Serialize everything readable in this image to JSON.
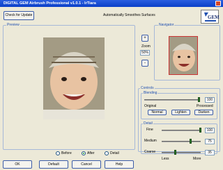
{
  "window": {
    "title": "DIGITAL GEM Airbrush Professional v1.0.1 - IrTiara"
  },
  "header": {
    "check_update": "Check for Update",
    "subtitle": "Automatically Smoothes Surfaces",
    "logo_text": "GEM"
  },
  "preview": {
    "label": "Preview"
  },
  "zoom": {
    "plus": "+",
    "label": "Zoom",
    "value": "50%",
    "minus": "-"
  },
  "navigator": {
    "label": "Navigator"
  },
  "controls": {
    "label": "Controls",
    "blending": {
      "label": "Blending",
      "value": "100",
      "left": "Original",
      "right": "Processed",
      "buttons": [
        "Normal",
        "Lighten",
        "Darken"
      ]
    },
    "detail": {
      "label": "Detail",
      "rows": [
        {
          "label": "Fine",
          "value": "100"
        },
        {
          "label": "Medium",
          "value": "75"
        },
        {
          "label": "Coarse",
          "value": "35"
        }
      ],
      "less": "Less",
      "more": "More"
    }
  },
  "view": {
    "options": [
      "Before",
      "After",
      "Detail"
    ],
    "selected": "After"
  },
  "footer": {
    "ok": "OK",
    "default": "Default",
    "cancel": "Cancel",
    "help": "Help"
  }
}
